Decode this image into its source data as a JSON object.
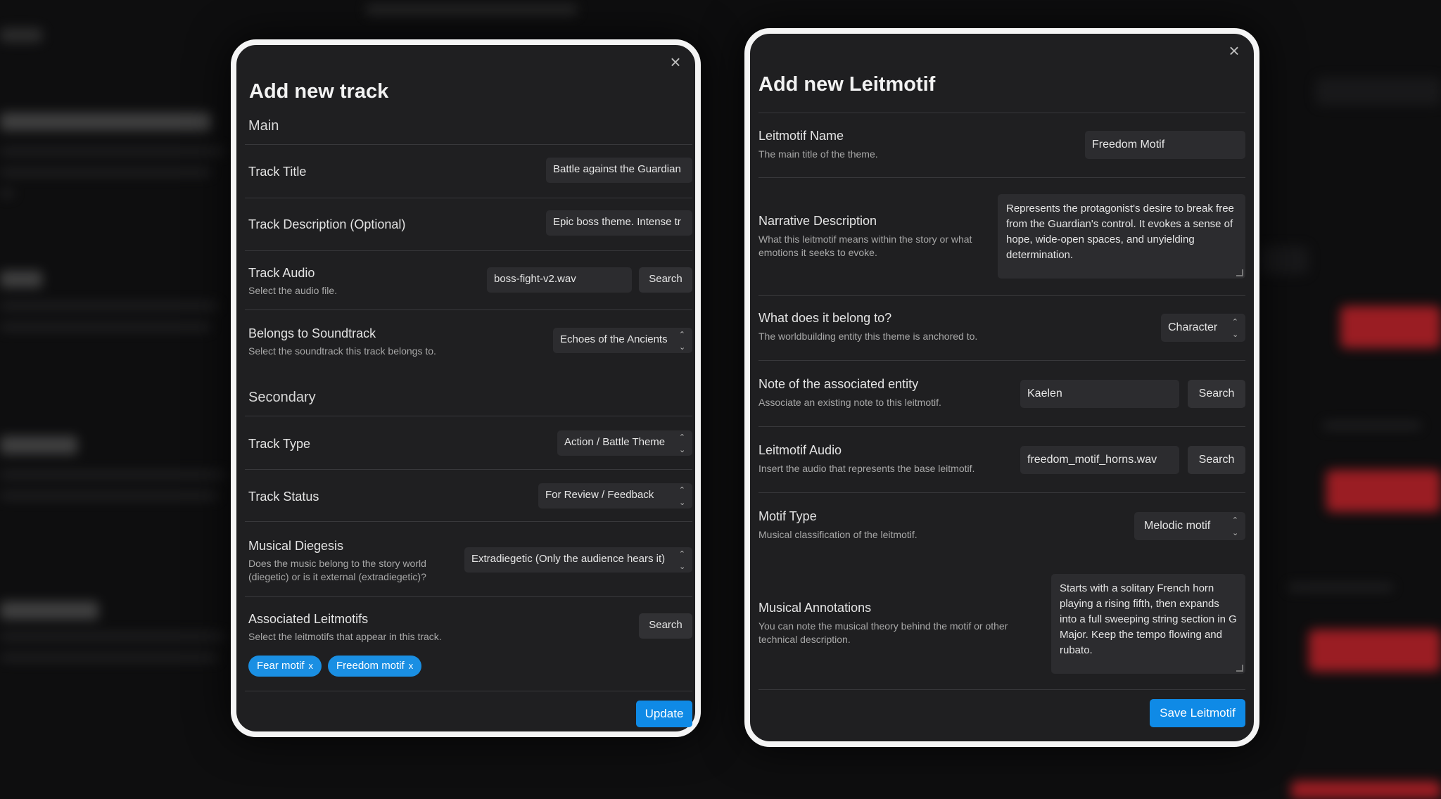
{
  "track_modal": {
    "title": "Add new track",
    "section_main": "Main",
    "section_secondary": "Secondary",
    "fields": {
      "track_title": {
        "label": "Track Title",
        "value": "Battle against the Guardian"
      },
      "track_description": {
        "label": "Track Description (Optional)",
        "value": "Epic boss theme. Intense tr"
      },
      "track_audio": {
        "label": "Track Audio",
        "hint": "Select the audio file.",
        "value": "boss-fight-v2.wav",
        "button": "Search"
      },
      "soundtrack": {
        "label": "Belongs to Soundtrack",
        "hint": "Select the soundtrack this track belongs to.",
        "value": "Echoes of the Ancients"
      },
      "track_type": {
        "label": "Track Type",
        "value": "Action / Battle Theme"
      },
      "track_status": {
        "label": "Track Status",
        "value": "For Review / Feedback"
      },
      "diegesis": {
        "label": "Musical Diegesis",
        "hint": "Does the music belong to the story world (diegetic) or is it external (extradiegetic)?",
        "value": "Extradiegetic (Only the audience hears it)"
      },
      "leitmotifs": {
        "label": "Associated Leitmotifs",
        "hint": "Select the leitmotifs that appear in this track.",
        "button": "Search",
        "chips": [
          "Fear motif",
          "Freedom motif"
        ]
      }
    },
    "submit": "Update"
  },
  "leitmotif_modal": {
    "title": "Add new Leitmotif",
    "fields": {
      "name": {
        "label": "Leitmotif Name",
        "hint": "The main title of the theme.",
        "value": "Freedom Motif"
      },
      "narrative": {
        "label": "Narrative Description",
        "hint": "What this leitmotif means within the story or what emotions it seeks to evoke.",
        "value": "Represents the protagonist's desire to break free from the Guardian's control. It evokes a sense of hope, wide-open spaces, and unyielding determination."
      },
      "belongs": {
        "label": "What does it belong to?",
        "hint": "The worldbuilding entity this theme is anchored to.",
        "value": "Character"
      },
      "entity_note": {
        "label": "Note of the associated entity",
        "hint": "Associate an existing note to this leitmotif.",
        "value": "Kaelen",
        "button": "Search"
      },
      "audio": {
        "label": "Leitmotif Audio",
        "hint": "Insert the audio that represents the base leitmotif.",
        "value": "freedom_motif_horns.wav",
        "button": "Search"
      },
      "motif_type": {
        "label": "Motif Type",
        "hint": "Musical classification of the leitmotif.",
        "value": "Melodic motif"
      },
      "annotations": {
        "label": "Musical Annotations",
        "hint": "You can note the musical theory behind the motif or other technical description.",
        "value": "Starts with a solitary French horn playing a rising fifth, then expands into a full sweeping string section in G Major. Keep the tempo flowing and rubato."
      }
    },
    "submit": "Save Leitmotif"
  },
  "icons": {
    "close": "close-icon",
    "chevron": "chevron-up-down-icon",
    "remove": "remove-chip-icon"
  },
  "colors": {
    "accent": "#0f8ae6",
    "chip": "#1a8fe3",
    "modal_bg": "#1f1f21",
    "modal_border": "#f5f5f5",
    "background_alert": "#d6242c"
  }
}
